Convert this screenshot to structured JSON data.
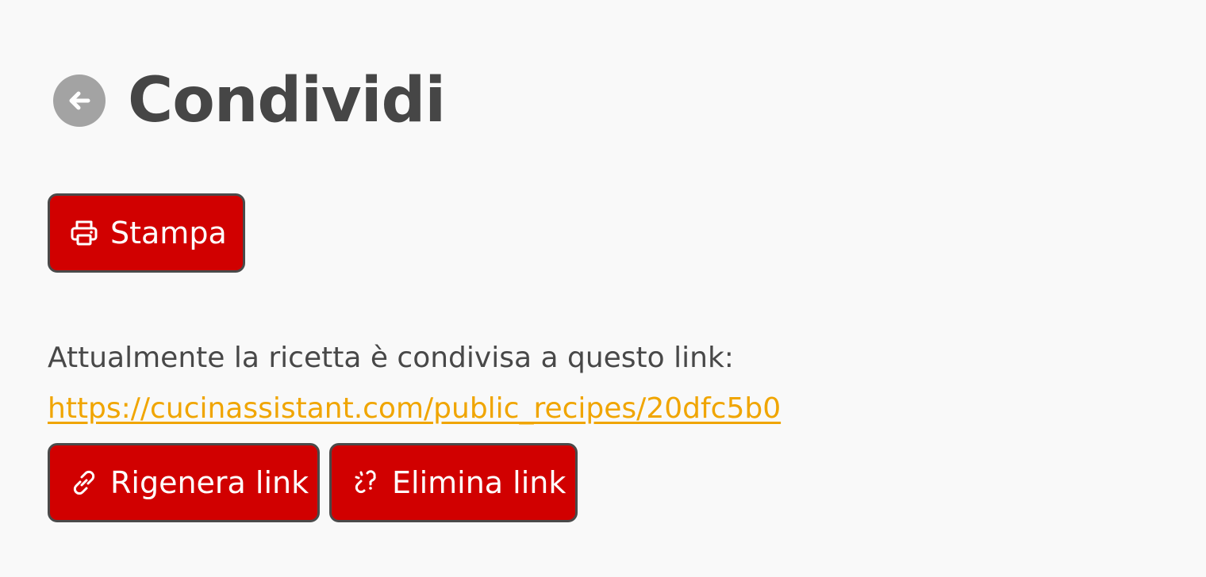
{
  "header": {
    "back_icon": "arrow-left-circle-icon",
    "title": "Condividi"
  },
  "actions": {
    "print": {
      "label": "Stampa",
      "icon": "printer-icon"
    }
  },
  "share": {
    "description": "Attualmente la ricetta è condivisa a questo link:",
    "url": "https://cucinassistant.com/public_recipes/20dfc5b0",
    "regenerate": {
      "label": "Rigenera link",
      "icon": "link-icon"
    },
    "delete": {
      "label": "Elimina link",
      "icon": "link-broken-icon"
    }
  },
  "colors": {
    "background": "#f9f9f9",
    "button_red": "#d10000",
    "button_border": "#4a4a4a",
    "link_orange": "#f0a500",
    "text": "#484848",
    "back_circle": "#a3a3a3"
  }
}
